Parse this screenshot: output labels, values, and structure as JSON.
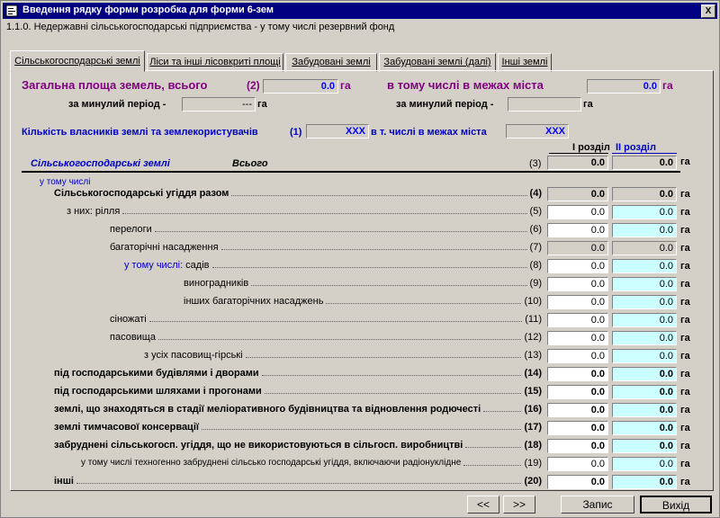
{
  "window": {
    "title": "Введення рядку форми розробка для форми 6-зем",
    "close_label": "X"
  },
  "subtitle": "1.1.0. Недержавні сільськогосподарські підприємства - у тому числі резервний фонд",
  "tabs": [
    {
      "label": "Сільськогосподарські землі"
    },
    {
      "label": "Ліси та інші лісовкриті площі"
    },
    {
      "label": "Забудовані землі"
    },
    {
      "label": "Забудовані землі (далі)"
    },
    {
      "label": "Інші землі"
    }
  ],
  "summary": {
    "total_label": "Загальна площа земель, всього",
    "total_code": "(2)",
    "total_value": "0.0",
    "unit": "га",
    "city_label": "в тому числі в межах міста",
    "city_value": "0.0",
    "prev_label": "за минулий період -",
    "prev_value": "---",
    "prev_city_label": "за минулий період -",
    "prev_city_value": "",
    "owners_label": "Кількість власників землі та землекористувачів",
    "owners_code": "(1)",
    "owners_value": "XXX",
    "owners_city_label": "в т. числі в межах міста",
    "owners_city_value": "XXX"
  },
  "columns": {
    "col1": "І розділ",
    "col2": "ІІ розділ"
  },
  "header_row": {
    "label": "Сільськогосподарські землі",
    "sub": "Всього",
    "code": "(3)",
    "v1": "0.0",
    "v2": "0.0",
    "unit": "га"
  },
  "incl_label": "у тому числі",
  "rows": [
    {
      "label": "Сільськогосподарські угіддя разом",
      "code": "(4)",
      "v1": "0.0",
      "v2": "0.0",
      "unit": "га"
    },
    {
      "label": "з них: рілля",
      "code": "(5)",
      "v1": "0.0",
      "v2": "0.0",
      "unit": "га"
    },
    {
      "label": "перелоги",
      "code": "(6)",
      "v1": "0.0",
      "v2": "0.0",
      "unit": "га"
    },
    {
      "label": "багаторічні насадження",
      "code": "(7)",
      "v1": "0.0",
      "v2": "0.0",
      "unit": "га"
    },
    {
      "prefix": "у тому числі:",
      "label": " садів",
      "code": "(8)",
      "v1": "0.0",
      "v2": "0.0",
      "unit": "га"
    },
    {
      "label": "виноградників",
      "code": "(9)",
      "v1": "0.0",
      "v2": "0.0",
      "unit": "га"
    },
    {
      "label": "інших багаторічних насаджень",
      "code": "(10)",
      "v1": "0.0",
      "v2": "0.0",
      "unit": "га"
    },
    {
      "label": "сіножаті",
      "code": "(11)",
      "v1": "0.0",
      "v2": "0.0",
      "unit": "га"
    },
    {
      "label": "пасовища",
      "code": "(12)",
      "v1": "0.0",
      "v2": "0.0",
      "unit": "га"
    },
    {
      "label": "з усіх пасовищ-гірські",
      "code": "(13)",
      "v1": "0.0",
      "v2": "0.0",
      "unit": "га"
    },
    {
      "label": "під господарськими будівлями і дворами",
      "code": "(14)",
      "v1": "0.0",
      "v2": "0.0",
      "unit": "га"
    },
    {
      "label": "під господарськими шляхами і прогонами",
      "code": "(15)",
      "v1": "0.0",
      "v2": "0.0",
      "unit": "га"
    },
    {
      "label": "землі, що знаходяться в стадії меліоративного будівництва та відновлення родючесті",
      "code": "(16)",
      "v1": "0.0",
      "v2": "0.0",
      "unit": "га"
    },
    {
      "label": "землі тимчасової консервації",
      "code": "(17)",
      "v1": "0.0",
      "v2": "0.0",
      "unit": "га"
    },
    {
      "label": "забруднені сільськогосп. угіддя, що не використовуються в сільгосп. виробництві",
      "code": "(18)",
      "v1": "0.0",
      "v2": "0.0",
      "unit": "га"
    },
    {
      "label": "у тому числі техногенно забруднені сільсько господарські угіддя, включаючи радіонуклідне",
      "code": "(19)",
      "v1": "0.0",
      "v2": "0.0",
      "unit": "га"
    },
    {
      "label": "інші",
      "code": "(20)",
      "v1": "0.0",
      "v2": "0.0",
      "unit": "га"
    }
  ],
  "buttons": {
    "prev": "<<",
    "next": ">>",
    "save": "Запис",
    "exit": "Вихід"
  },
  "colors": {
    "titlebar": "#000080",
    "purple": "#800080",
    "blue": "#0000c0",
    "cyan": "#ccffff"
  }
}
